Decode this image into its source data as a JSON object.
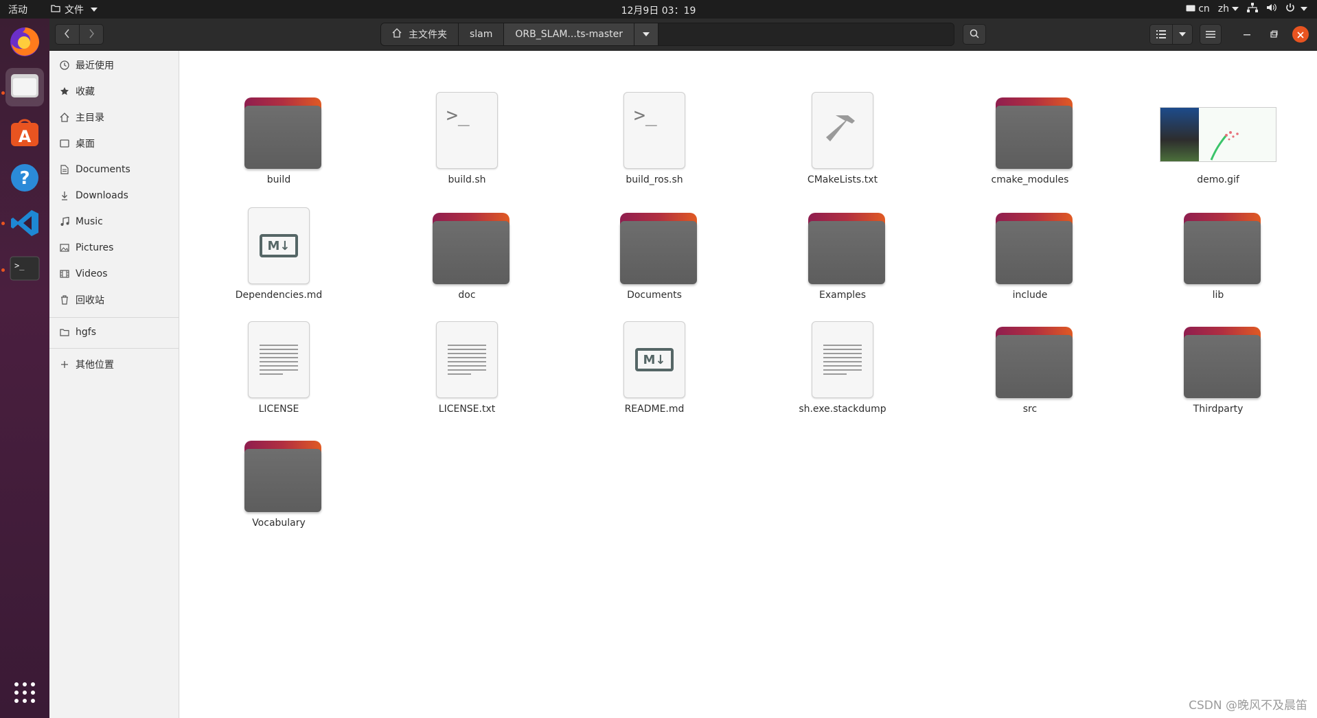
{
  "topbar": {
    "activities": "活动",
    "app_menu": "文件",
    "clock": "12月9日  03：19",
    "input_method": "cn",
    "language": "zh"
  },
  "dock": {
    "items": [
      "firefox-icon",
      "files-icon",
      "software-icon",
      "help-icon",
      "vscode-icon",
      "terminal-icon"
    ],
    "apps_grid": "show-apps-icon"
  },
  "headerbar": {
    "breadcrumbs": [
      "主文件夹",
      "slam",
      "ORB_SLAM...ts-master"
    ]
  },
  "sidebar": {
    "items": [
      {
        "label": "最近使用",
        "icon": "clock-icon"
      },
      {
        "label": "收藏",
        "icon": "star-icon"
      },
      {
        "label": "主目录",
        "icon": "home-icon"
      },
      {
        "label": "桌面",
        "icon": "desktop-icon"
      },
      {
        "label": "Documents",
        "icon": "document-icon"
      },
      {
        "label": "Downloads",
        "icon": "download-icon"
      },
      {
        "label": "Music",
        "icon": "music-icon"
      },
      {
        "label": "Pictures",
        "icon": "picture-icon"
      },
      {
        "label": "Videos",
        "icon": "video-icon"
      },
      {
        "label": "回收站",
        "icon": "trash-icon"
      }
    ],
    "network": {
      "label": "hgfs",
      "icon": "folder-icon"
    },
    "other": {
      "label": "其他位置",
      "icon": "plus-icon"
    }
  },
  "files": [
    {
      "name": "build",
      "type": "folder"
    },
    {
      "name": "build.sh",
      "type": "script"
    },
    {
      "name": "build_ros.sh",
      "type": "script"
    },
    {
      "name": "CMakeLists.txt",
      "type": "cmake"
    },
    {
      "name": "cmake_modules",
      "type": "folder"
    },
    {
      "name": "demo.gif",
      "type": "image"
    },
    {
      "name": "Dependencies.md",
      "type": "markdown"
    },
    {
      "name": "doc",
      "type": "folder"
    },
    {
      "name": "Documents",
      "type": "folder"
    },
    {
      "name": "Examples",
      "type": "folder"
    },
    {
      "name": "include",
      "type": "folder"
    },
    {
      "name": "lib",
      "type": "folder"
    },
    {
      "name": "LICENSE",
      "type": "text"
    },
    {
      "name": "LICENSE.txt",
      "type": "text"
    },
    {
      "name": "README.md",
      "type": "markdown"
    },
    {
      "name": "sh.exe.stackdump",
      "type": "text"
    },
    {
      "name": "src",
      "type": "folder"
    },
    {
      "name": "Thirdparty",
      "type": "folder"
    },
    {
      "name": "Vocabulary",
      "type": "folder"
    }
  ],
  "watermark": "CSDN @晚风不及晨笛",
  "colors": {
    "accent": "#e95420",
    "folder_top": "#b12f41",
    "folder_body": "#646464"
  }
}
